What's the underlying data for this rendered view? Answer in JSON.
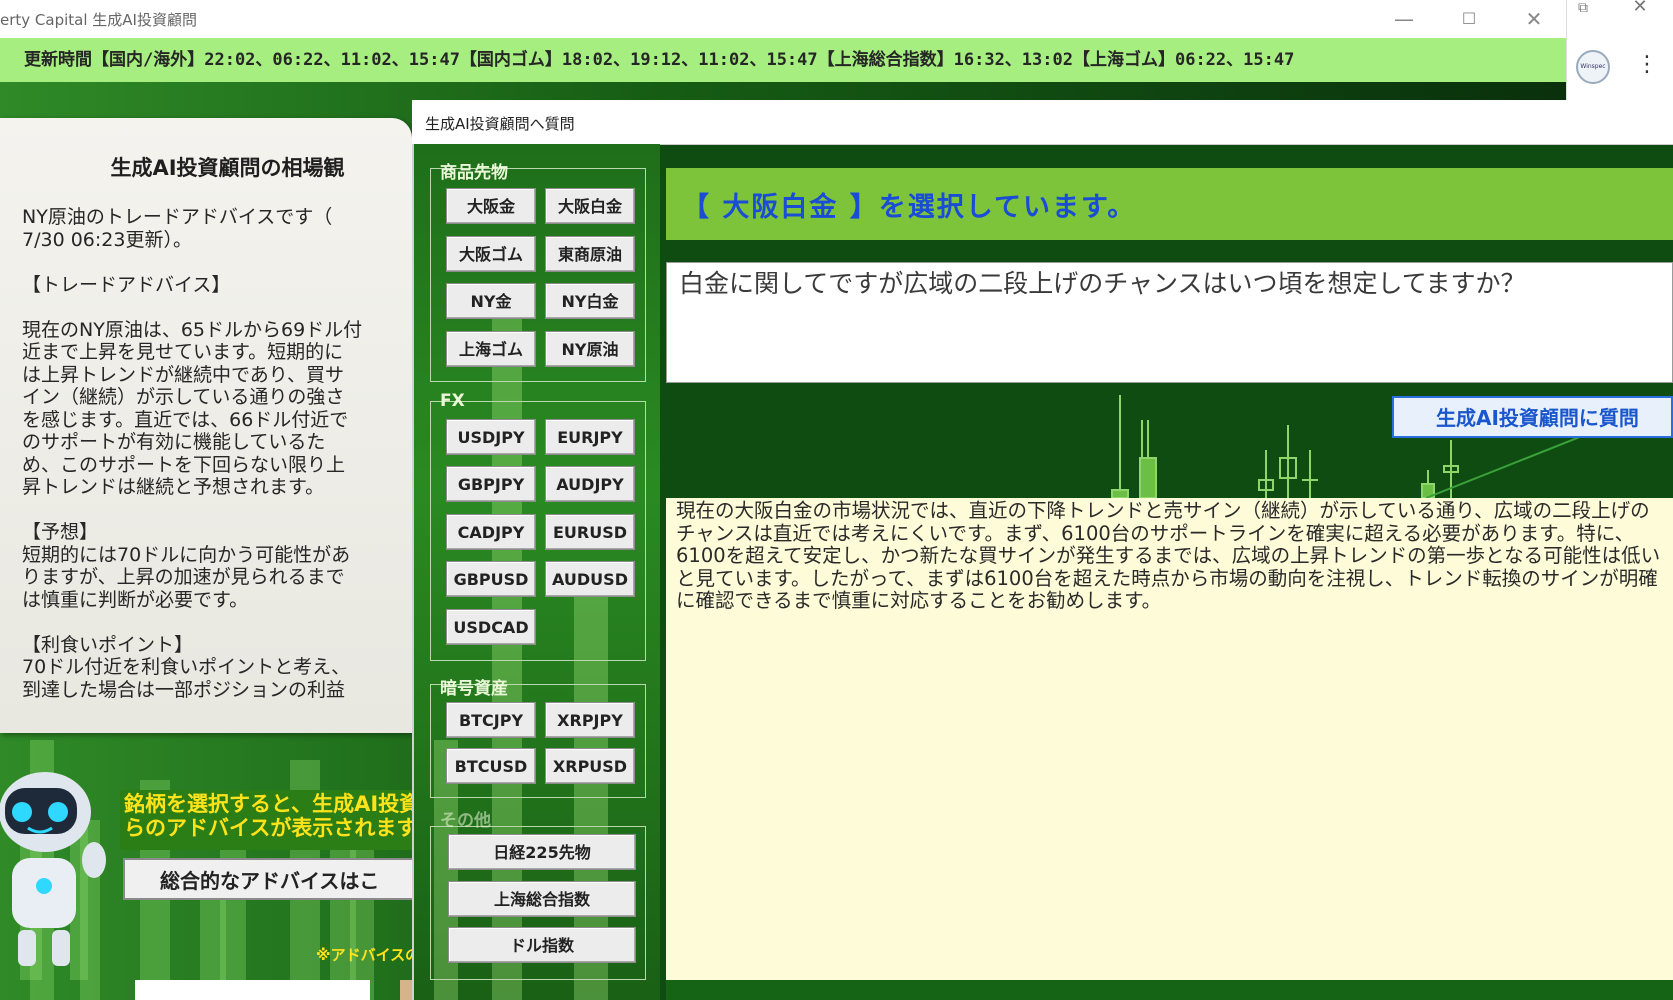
{
  "window": {
    "title": "erty Capital 生成AI投資顧問",
    "minimize_icon": "minimize-icon",
    "maximize_icon": "maximize-icon",
    "close_icon": "close-icon"
  },
  "banner": {
    "text": "更新時間【国内/海外】22:02、06:22、11:02、15:47【国内ゴム】18:02、19:12、11:02、15:47【上海総合指数】16:32、13:02【上海ゴム】06:22、15:47"
  },
  "side_window": {
    "avatar_label": "Winspec"
  },
  "left_panel": {
    "title": "生成AI投資顧問の相場観",
    "body": "NY原油のトレードアドバイスです（\n7/30 06:23更新）。\n\n【トレードアドバイス】\n\n現在のNY原油は、65ドルから69ドル付\n近まで上昇を見せています。短期的に\nは上昇トレンドが継続中であり、買サ\nイン（継続）が示している通りの強さ\nを感じます。直近では、66ドル付近で\nのサポートが有効に機能しているた\nめ、このサポートを下回らない限り上\n昇トレンドは継続と予想されます。\n\n【予想】\n短期的には70ドルに向かう可能性があ\nりますが、上昇の加速が見られるまで\nは慎重に判断が必要です。\n\n【利食いポイント】\n70ドル付近を利食いポイントと考え、\n到達した場合は一部ポジションの利益",
    "hint_line1": "銘柄を選択すると、生成AI投資",
    "hint_line2": "らのアドバイスが表示されます。",
    "overall_button": "総合的なアドバイスはこ",
    "note": "※アドバイスの"
  },
  "dialog": {
    "title": "生成AI投資顧問へ質問",
    "groups": {
      "commodities": {
        "label": "商品先物",
        "buttons": [
          "大阪金",
          "大阪白金",
          "大阪ゴム",
          "東商原油",
          "NY金",
          "NY白金",
          "上海ゴム",
          "NY原油"
        ]
      },
      "fx": {
        "label": "FX",
        "buttons": [
          "USDJPY",
          "EURJPY",
          "GBPJPY",
          "AUDJPY",
          "CADJPY",
          "EURUSD",
          "GBPUSD",
          "AUDUSD",
          "USDCAD"
        ]
      },
      "crypto": {
        "label": "暗号資産",
        "buttons": [
          "BTCJPY",
          "XRPJPY",
          "BTCUSD",
          "XRPUSD"
        ]
      },
      "other": {
        "label": "その他",
        "buttons": [
          "日経225先物",
          "上海総合指数",
          "ドル指数"
        ]
      }
    },
    "selected_text": "【 大阪白金 】を選択しています。",
    "question": "白金に関してですが広域の二段上げのチャンスはいつ頃を想定してますか？",
    "ask_button": "生成AI投資顧問に質問",
    "answer": "現在の大阪白金の市場状況では、直近の下降トレンドと売サイン（継続）が示している通り、広域の二段上げのチャンスは直近では考えにくいです。まず、6100台のサポートラインを確実に超える必要があります。特に、6100を超えて安定し、かつ新たな買サインが発生するまでは、広域の上昇トレンドの第一歩となる可能性は低いと見ています。したがって、まずは6100台を超えた時点から市場の動向を注視し、トレンド転換のサインが明確に確認できるまで慎重に対応することをお勧めします。"
  },
  "colors": {
    "banner_bg": "#a5ee7f",
    "selected_bg": "#7ec43b",
    "selected_text": "#1a4dd6",
    "answer_bg": "#fefcd8",
    "hint_text": "#ffe31a"
  }
}
